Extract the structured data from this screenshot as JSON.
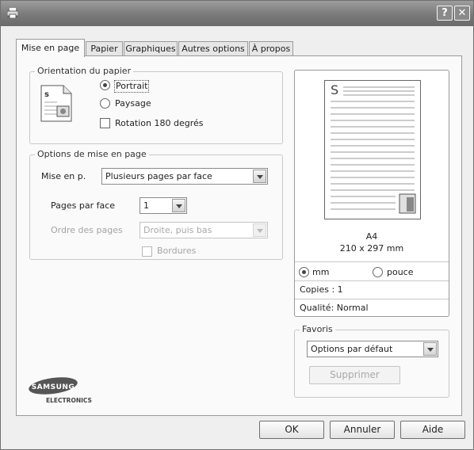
{
  "window": {
    "minimize_glyph": "?",
    "close_glyph": "✕",
    "icon": "printer-icon"
  },
  "tabs": [
    {
      "label": "Mise en page",
      "active": true
    },
    {
      "label": "Papier",
      "active": false
    },
    {
      "label": "Graphiques",
      "active": false
    },
    {
      "label": "Autres options",
      "active": false
    },
    {
      "label": "À propos",
      "active": false
    }
  ],
  "orientation": {
    "legend": "Orientation du papier",
    "page_icon_letter": "s",
    "portrait_label": "Portrait",
    "landscape_label": "Paysage",
    "rotate_label": "Rotation 180 degrés",
    "selected": "Portrait",
    "rotate_checked": false
  },
  "layout_options": {
    "legend": "Options de mise en page",
    "layout_label": "Mise en p.",
    "layout_value": "Plusieurs pages par face",
    "pages_per_side_label": "Pages par face",
    "pages_per_side_value": "1",
    "page_order_label": "Ordre des pages",
    "page_order_value": "Droite, puis bas",
    "borders_label": "Bordures",
    "borders_checked": false
  },
  "preview": {
    "page_letter": "S",
    "paper_name": "A4",
    "paper_size": "210 x 297 mm",
    "unit_mm_label": "mm",
    "unit_inch_label": "pouce",
    "selected_unit": "mm",
    "copies_text": "Copies : 1",
    "quality_text": "Qualité: Normal"
  },
  "favorites": {
    "legend": "Favoris",
    "value": "Options par défaut",
    "delete_label": "Supprimer"
  },
  "logo": {
    "brand": "SAMSUNG",
    "sub": "ELECTRONICS"
  },
  "footer": {
    "ok_label": "OK",
    "cancel_label": "Annuler",
    "help_label": "Aide"
  },
  "colors": {
    "titlebar": "#7a7a7a",
    "panel": "#fafafa",
    "dialog": "#efefef"
  }
}
